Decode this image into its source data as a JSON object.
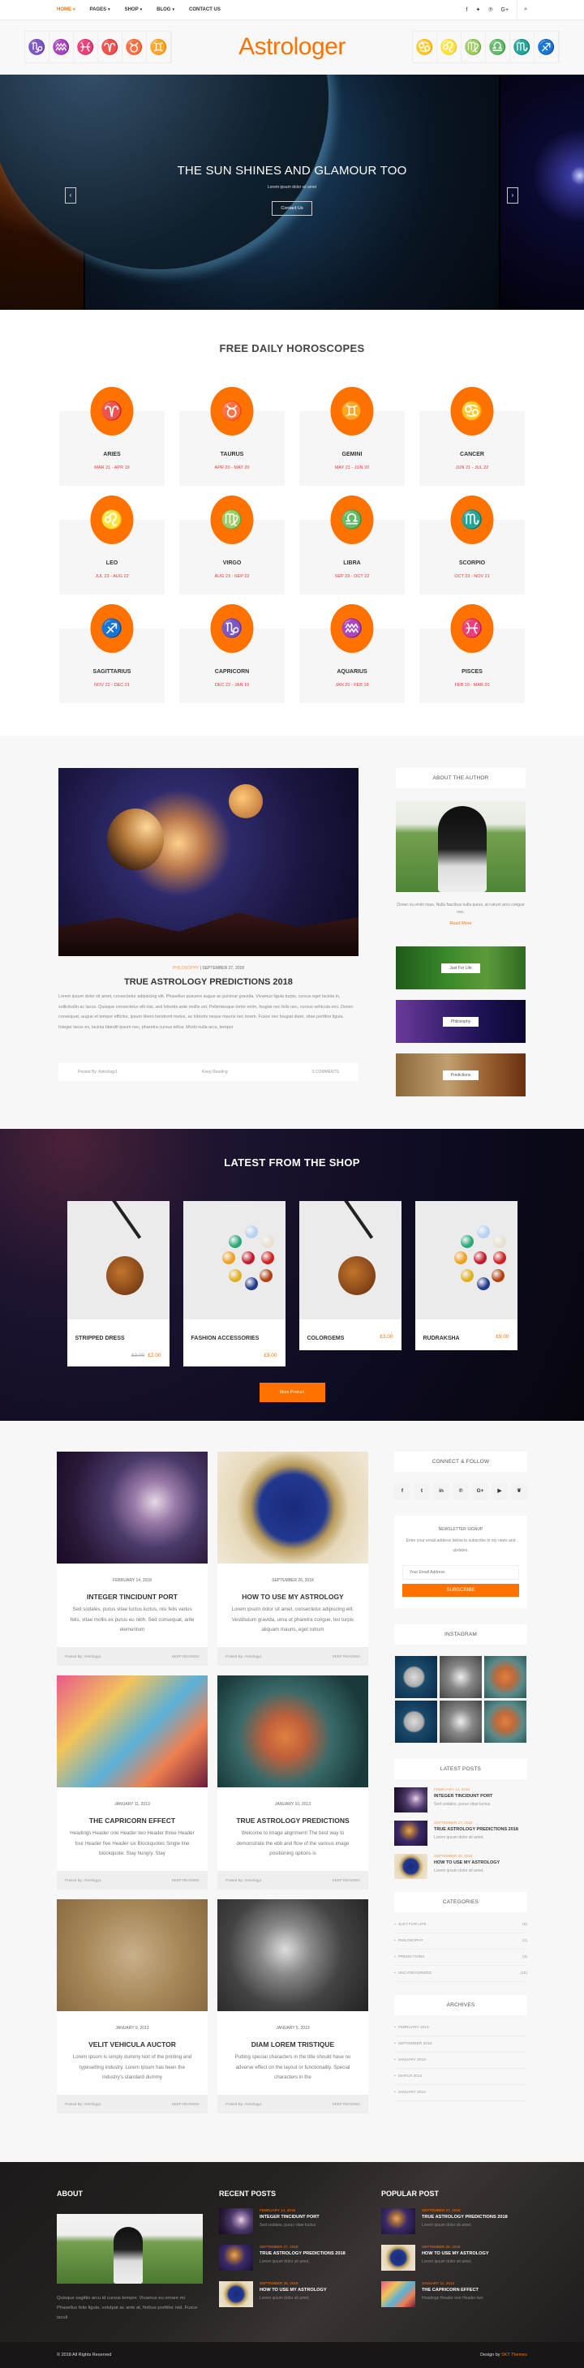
{
  "nav": {
    "items": [
      {
        "label": "HOME",
        "chevron": true,
        "active": true
      },
      {
        "label": "PAGES",
        "chevron": true
      },
      {
        "label": "SHOP",
        "chevron": true
      },
      {
        "label": "BLOG",
        "chevron": true
      },
      {
        "label": "CONTACT US",
        "chevron": false
      }
    ],
    "social": [
      "facebook-icon",
      "twitter-icon",
      "pinterest-icon",
      "google-plus-icon"
    ],
    "social_glyphs": [
      "f",
      "🐦",
      "℗",
      "G+"
    ],
    "search_glyph": "⌕"
  },
  "brand": {
    "logo": "Astrologer",
    "accent": "#ff7200"
  },
  "header_signs_left": [
    "♑",
    "♒",
    "♓",
    "♈",
    "♉",
    "♊"
  ],
  "header_signs_right": [
    "♋",
    "♌",
    "♍",
    "♎",
    "♏",
    "♐"
  ],
  "hero": {
    "title": "THE SUN SHINES AND GLAMOUR TOO",
    "subtitle": "Lorem ipsum dolor sit amet",
    "button": "Contact Us",
    "prev": "‹",
    "next": "›"
  },
  "horoscopes": {
    "title": "FREE DAILY HOROSCOPES",
    "signs": [
      {
        "name": "ARIES",
        "dates": "MAR 21 - APR 19",
        "glyph": "♈"
      },
      {
        "name": "TAURUS",
        "dates": "APR 20 - MAY 20",
        "glyph": "♉"
      },
      {
        "name": "GEMINI",
        "dates": "MAY 21 - JUN 20",
        "glyph": "♊"
      },
      {
        "name": "CANCER",
        "dates": "JUN 21 - JUL 22",
        "glyph": "♋"
      },
      {
        "name": "LEO",
        "dates": "JUL 23 - AUG 22",
        "glyph": "♌"
      },
      {
        "name": "VIRGO",
        "dates": "AUG 23 - SEP 22",
        "glyph": "♍"
      },
      {
        "name": "LIBRA",
        "dates": "SEP 23 - OCT 22",
        "glyph": "♎"
      },
      {
        "name": "SCORPIO",
        "dates": "OCT 23 - NOV 21",
        "glyph": "♏"
      },
      {
        "name": "SAGITTARIUS",
        "dates": "NOV 22 - DEC 21",
        "glyph": "♐"
      },
      {
        "name": "CAPRICORN",
        "dates": "DEC 22 - JAN 19",
        "glyph": "♑"
      },
      {
        "name": "AQUARIUS",
        "dates": "JAN 20 - FEB 18",
        "glyph": "♒"
      },
      {
        "name": "PISCES",
        "dates": "FEB 19 - MAR 20",
        "glyph": "♓"
      }
    ]
  },
  "featured": {
    "category": "PHILOSOPHY",
    "date": " | SEPTEMBER 27, 2018",
    "title": "TRUE ASTROLOGY PREDICTIONS 2018",
    "text": "Lorem ipsum dolor sit amet, consectetur adipiscing elit. Phasellus posuere augue ac pulvinar gravida. Vivamus ligula turpis, cursus eget lacinia in, sollicitudin ac lacus. Quisque consectetur elit nisi, sed lobortis ante mollis vel. Pellentesque tortor enim, feugiat nec felis nec, cursus vehicula orci. Donec consequat, augue et tempor efficitur, ipsum libero hendrerit metus, ac lobortis neque mauris nec lorem. Fusce nec feugiat diam, vitae porttitor ligula. Integer lacus ex, lacinia blandit ipsum nec, pharetra cursus tellus. Morbi nulla arcu, tempor",
    "posted_by": "Posted By: Astrology1",
    "keep_reading": "Keep Reading",
    "comments": "0 COMMENTS"
  },
  "about_author": {
    "title": "ABOUT THE AUTHOR",
    "text": "Donec eu enim risus. Nulla faucibus nulla purus, at rutrum arcu congue nec.",
    "read_more": "Read More",
    "categories": [
      "Just For Life",
      "Philosophy",
      "Predictions"
    ]
  },
  "shop": {
    "title": "LATEST FROM THE SHOP",
    "products": [
      {
        "name": "STRIPPED DRESS",
        "old_price": "£3.00",
        "price": "£2.00",
        "image": "bead"
      },
      {
        "name": "FASHION ACCESSORIES",
        "old_price": "",
        "price": "£9.00",
        "image": "gems"
      },
      {
        "name": "COLORGEMS",
        "old_price": "",
        "price": "£3.00",
        "image": "bead"
      },
      {
        "name": "RUDRAKSHA",
        "old_price": "",
        "price": "£9.00",
        "image": "gems"
      }
    ],
    "more_button": "More Product"
  },
  "posts": [
    {
      "date": "FEBRUARY 14, 2018",
      "title": "INTEGER TINCIDUNT PORT",
      "excerpt": "Sed sodales, purus vitae luctus luctus, nisi felis varius felis, vitae mollis ex purus eu nibh. Sed consequat, ante elementum",
      "posted_by": "Posted By: Astrology1",
      "keep": "KEEP READING",
      "img": "i1"
    },
    {
      "date": "SEPTEMBER 26, 2018",
      "title": "HOW TO USE MY ASTROLOGY",
      "excerpt": "Lorem ipsum dolor sit amet, consectetur adipiscing elit. Vestibulum gravida, urna ut pharetra congue, leo turpis aliquam mauris, eget rutrum",
      "posted_by": "Posted By: Astrology1",
      "keep": "KEEP READING",
      "img": "i2"
    },
    {
      "date": "JANUARY 11, 2013",
      "title": "THE CAPRICORN EFFECT",
      "excerpt": "Headings Header one Header two Header three Header four Header five Header six Blockquotes Single line blockquote: Stay hungry. Stay",
      "posted_by": "Posted By: Astrology1",
      "keep": "KEEP READING",
      "img": "i3"
    },
    {
      "date": "JANUARY 10, 2013",
      "title": "TRUE ASTROLOGY PREDICTIONS",
      "excerpt": "Welcome to image alignment! The best way to demonstrate the ebb and flow of the various image positioning options is",
      "posted_by": "Posted By: Astrology1",
      "keep": "KEEP READING",
      "img": "i4"
    },
    {
      "date": "JANUARY 9, 2013",
      "title": "VELIT VEHICULA AUCTOR",
      "excerpt": "Lorem Ipsum is simply dummy text of the printing and typesetting industry. Lorem Ipsum has been the industry's standard dummy",
      "posted_by": "Posted By: Astrology1",
      "keep": "KEEP READING",
      "img": "i5"
    },
    {
      "date": "JANUARY 5, 2013",
      "title": "DIAM LOREM TRISTIQUE",
      "excerpt": "Putting special characters in the title should have no adverse effect on the layout or functionality. Special characters in the",
      "posted_by": "Posted By: Astrology1",
      "keep": "KEEP READING",
      "img": "i6"
    }
  ],
  "sidebar": {
    "connect_title": "CONNECT & FOLLOW",
    "social": [
      {
        "name": "facebook-icon",
        "glyph": "f"
      },
      {
        "name": "twitter-icon",
        "glyph": "t"
      },
      {
        "name": "linkedin-icon",
        "glyph": "in"
      },
      {
        "name": "pinterest-icon",
        "glyph": "℗"
      },
      {
        "name": "google-plus-icon",
        "glyph": "G+"
      },
      {
        "name": "youtube-icon",
        "glyph": "▶"
      },
      {
        "name": "leaf-icon",
        "glyph": "❦"
      }
    ],
    "newsletter": {
      "title": "NEWSLETTER SIGNUP",
      "text": "Enter your email address below to subscribe to my news and updates.",
      "placeholder": "Your Email Address",
      "button": "SUBSCRIBE"
    },
    "instagram_title": "INSTAGRAM",
    "instagram": [
      "moon",
      "aries",
      "scorp",
      "moon",
      "aries",
      "scorp"
    ],
    "latest_title": "LATEST POSTS",
    "latest": [
      {
        "date": "FEBRUARY 14, 2018",
        "title": "INTEGER TINCIDUNT PORT",
        "excerpt": "Sed sodales, purus vitae luctus",
        "img": "i1"
      },
      {
        "date": "SEPTEMBER 27, 2018",
        "title": "TRUE ASTROLOGY PREDICTIONS 2018",
        "excerpt": "Lorem ipsum dolor sit amet,",
        "img": "feat"
      },
      {
        "date": "SEPTEMBER 26, 2018",
        "title": "HOW TO USE MY ASTROLOGY",
        "excerpt": "Lorem ipsum dolor sit amet,",
        "img": "i2"
      }
    ],
    "categories_title": "CATEGORIES",
    "categories": [
      {
        "label": "JUST FOR LIFE",
        "count": "(6)"
      },
      {
        "label": "PHILOSOPHY",
        "count": "(1)"
      },
      {
        "label": "PREDICTIONS",
        "count": "(3)"
      },
      {
        "label": "UNCATEGORIZED",
        "count": "(12)"
      }
    ],
    "archives_title": "ARCHIVES",
    "archives": [
      "FEBRUARY 2018",
      "SEPTEMBER 2016",
      "JANUARY 2013",
      "MARCH 2012",
      "JANUARY 2012"
    ]
  },
  "footer": {
    "about_title": "ABOUT",
    "about_text": "Quisque sagittis arcu id cursus tempor. Vivamus eu ornare mi. Phasellus felis ligula, volutpat ac ante at, finibus porttitor nisl. Fusce iaculi",
    "recent_title": "RECENT POSTS",
    "recent": [
      {
        "date": "FEBRUARY 14, 2018",
        "title": "INTEGER TINCIDUNT PORT",
        "excerpt": "Sed sodales, purus vitae luctus",
        "img": "i1"
      },
      {
        "date": "SEPTEMBER 27, 2018",
        "title": "TRUE ASTROLOGY PREDICTIONS 2018",
        "excerpt": "Lorem ipsum dolor sit amet,",
        "img": "feat"
      },
      {
        "date": "SEPTEMBER 26, 2018",
        "title": "HOW TO USE MY ASTROLOGY",
        "excerpt": "Lorem ipsum dolor sit amet,",
        "img": "i2"
      }
    ],
    "popular_title": "POPULAR POST",
    "popular": [
      {
        "date": "SEPTEMBER 27, 2018",
        "title": "TRUE ASTROLOGY PREDICTIONS 2018",
        "excerpt": "Lorem ipsum dolor sit amet,",
        "img": "feat"
      },
      {
        "date": "SEPTEMBER 26, 2018",
        "title": "HOW TO USE MY ASTROLOGY",
        "excerpt": "Lorem ipsum dolor sit amet,",
        "img": "i2"
      },
      {
        "date": "JANUARY 11, 2013",
        "title": "THE CAPRICORN EFFECT",
        "excerpt": "Headings Header one Header two",
        "img": "i3"
      }
    ],
    "copyright": "© 2018 All Rights Reserved",
    "design_by": "Design by ",
    "design_brand": "SKT Themes"
  }
}
